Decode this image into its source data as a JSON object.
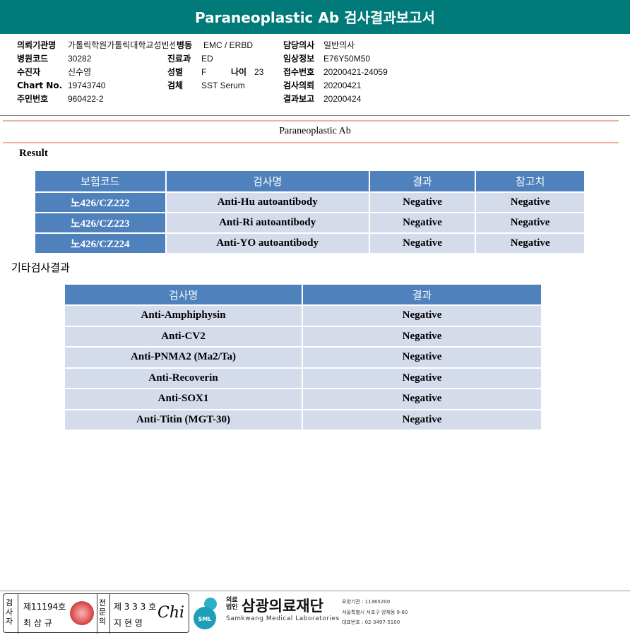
{
  "report_title": "Paraneoplastic Ab 검사결과보고서",
  "header": {
    "col1": [
      {
        "label": "의뢰기관명",
        "value": "가톨릭학원가톨릭대학교성빈센트병원"
      },
      {
        "label": "병원코드",
        "value": "30282"
      },
      {
        "label": "수진자",
        "value": "신수영"
      },
      {
        "label": "Chart No.",
        "value": "19743740"
      },
      {
        "label": "주민번호",
        "value": "960422-2"
      }
    ],
    "col2": {
      "ward_label": "병동",
      "ward_value": "EMC / ERBD",
      "dept_label": "진료과",
      "dept_value": "ED",
      "sex_label": "성별",
      "sex_value": "F",
      "age_label": "나이",
      "age_value": "23",
      "specimen_label": "검체",
      "specimen_value": "SST Serum"
    },
    "col3": [
      {
        "label": "담당의사",
        "value": "일반의사"
      },
      {
        "label": "임상정보",
        "value": "E76Y50M50"
      },
      {
        "label": "접수번호",
        "value": "20200421-24059"
      },
      {
        "label": "검사의뢰",
        "value": "20200421"
      },
      {
        "label": "결과보고",
        "value": "20200424"
      }
    ]
  },
  "section_title": "Paraneoplastic Ab",
  "result_label": "Result",
  "result_table": {
    "headers": [
      "보험코드",
      "검사명",
      "결과",
      "참고치"
    ],
    "rows": [
      {
        "code": "노426/CZ222",
        "test": "Anti-Hu autoantibody",
        "result": "Negative",
        "ref": "Negative"
      },
      {
        "code": "노426/CZ223",
        "test": "Anti-Ri autoantibody",
        "result": "Negative",
        "ref": "Negative"
      },
      {
        "code": "노426/CZ224",
        "test": "Anti-YO autoantibody",
        "result": "Negative",
        "ref": "Negative"
      }
    ]
  },
  "other_label": "기타검사결과",
  "other_table": {
    "headers": [
      "검사명",
      "결과"
    ],
    "rows": [
      {
        "test": "Anti-Amphiphysin",
        "result": "Negative"
      },
      {
        "test": "Anti-CV2",
        "result": "Negative"
      },
      {
        "test": "Anti-PNMA2 (Ma2/Ta)",
        "result": "Negative"
      },
      {
        "test": "Anti-Recoverin",
        "result": "Negative"
      },
      {
        "test": "Anti-SOX1",
        "result": "Negative"
      },
      {
        "test": "Anti-Titin (MGT-30)",
        "result": "Negative"
      }
    ]
  },
  "footer": {
    "tester_label": "검사자",
    "tester_no": "제11194호",
    "tester_name": "최 삼 규",
    "doctor_label": "전문의",
    "doctor_no": "제 3 3 3 호",
    "doctor_name": "지 현 영",
    "signature": "Chi",
    "logo_short": "SML",
    "corp_label_1": "의료",
    "corp_label_2": "법인",
    "org_name": "삼광의료재단",
    "org_english": "Samkwang Medical Laboratories",
    "contact_1": "요양기관 : 11365200",
    "contact_2": "서울특별시 서초구 양재동 9-60",
    "contact_3": "대표번호 : 02-3497-5100"
  }
}
